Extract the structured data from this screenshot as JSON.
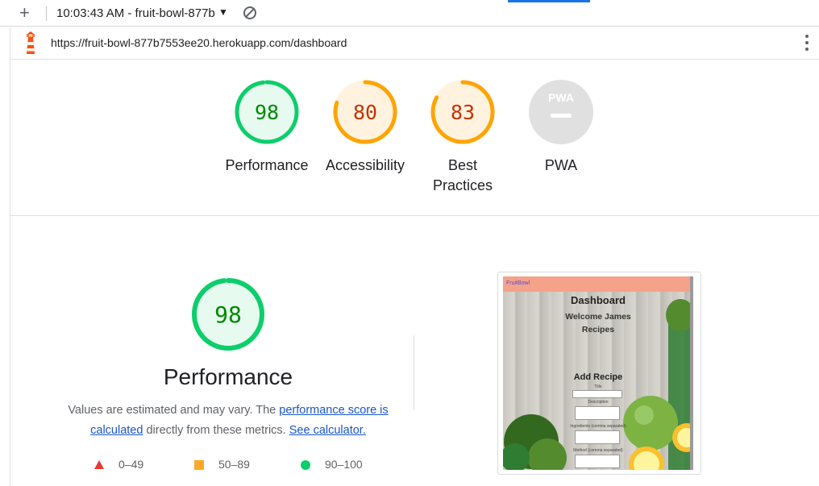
{
  "toolbar": {
    "new_label": "+",
    "session_title": "10:03:43 AM - fruit-bowl-877b",
    "caret": "▼"
  },
  "urlbar": {
    "url": "https://fruit-bowl-877b7553ee20.herokuapp.com/dashboard"
  },
  "scores": [
    {
      "label": "Performance",
      "value": "98",
      "fraction": 0.98,
      "status": "pass"
    },
    {
      "label": "Accessibility",
      "value": "80",
      "fraction": 0.8,
      "status": "average"
    },
    {
      "label": "Best Practices",
      "value": "83",
      "fraction": 0.83,
      "status": "average"
    },
    {
      "label": "PWA",
      "value": "",
      "fraction": 0,
      "status": "na",
      "badge": "PWA"
    }
  ],
  "performance": {
    "value": "98",
    "fraction": 0.98,
    "title": "Performance",
    "desc_prefix": "Values are estimated and may vary. The ",
    "score_link": "performance score is calculated",
    "desc_mid": " directly from these metrics. ",
    "calc_link": "See calculator."
  },
  "legend": [
    {
      "range": "0–49",
      "shape": "triangle",
      "color": "#e53935"
    },
    {
      "range": "50–89",
      "shape": "square",
      "color": "#ffa726"
    },
    {
      "range": "90–100",
      "shape": "circle",
      "color": "#0cce6b"
    }
  ],
  "thumbnail": {
    "brand": "FruitBowl",
    "heading": "Dashboard",
    "welcome": "Welcome James",
    "recipes": "Recipes",
    "add_recipe": "Add Recipe",
    "field_title": "Title",
    "field_description": "Description",
    "field_ingredients": "Ingredients (comma separated)",
    "field_method": "Method (comma separated)"
  },
  "colors": {
    "pass": "#0cce6b",
    "pass_text": "#008800",
    "pass_fill": "#e6faef",
    "average": "#ffa400",
    "average_text": "#c33300",
    "average_fill": "#fff3e0",
    "na": "#e0e0e0"
  }
}
